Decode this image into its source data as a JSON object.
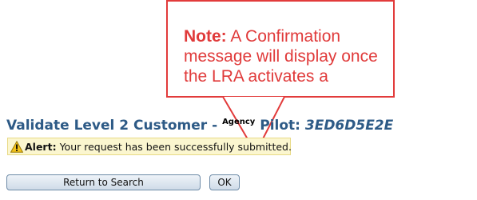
{
  "callout": {
    "note_label": "Note:",
    "note_text": " A Confirmation message will display once the LRA activates a"
  },
  "header": {
    "title": "Validate Level 2 Customer -",
    "agency": "Agency",
    "pilot_label": "Pilot:",
    "pilot_code": "3ED6D5E2E"
  },
  "alert": {
    "icon": "warning-icon",
    "label": "Alert:",
    "message": "Your request has been successfully submitted."
  },
  "buttons": {
    "return_label": "Return to Search",
    "ok_label": "OK"
  },
  "colors": {
    "callout_red": "#e23b3b",
    "title_blue": "#2d5a86",
    "alert_bg": "#fbf6cf"
  }
}
